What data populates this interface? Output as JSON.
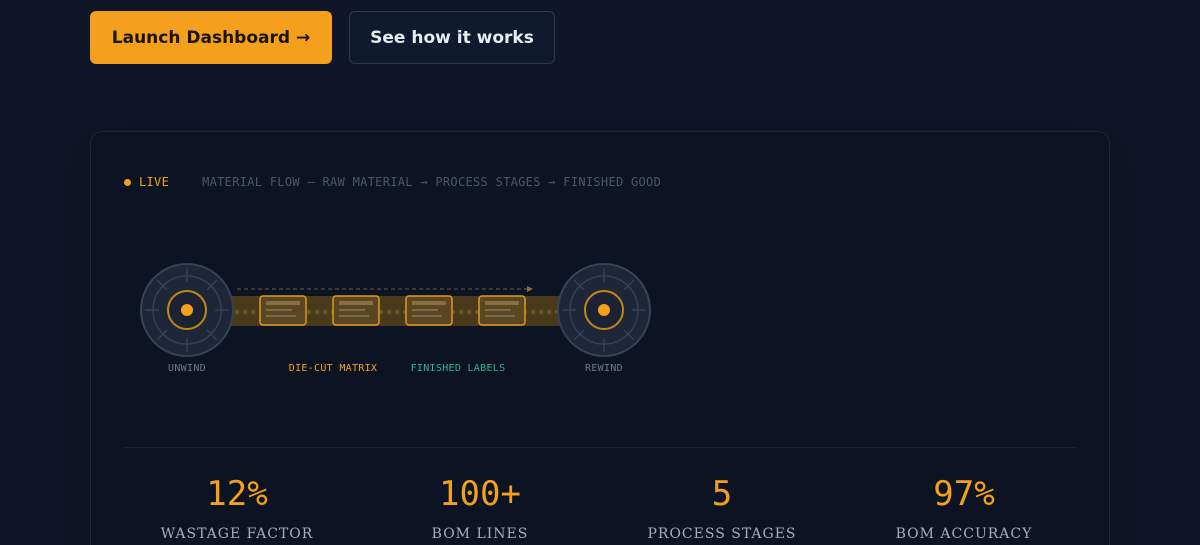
{
  "cta": {
    "primary_label": "Launch Dashboard →",
    "secondary_label": "See how it works"
  },
  "panel": {
    "live_label": "LIVE",
    "flow_caption": "MATERIAL FLOW — RAW MATERIAL → PROCESS STAGES → FINISHED GOOD",
    "captions": {
      "unwind": "UNWIND",
      "matrix": "DIE-CUT MATRIX",
      "labels": "FINISHED LABELS",
      "rewind": "REWIND"
    }
  },
  "stats": [
    {
      "value": "12%",
      "label": "WASTAGE FACTOR"
    },
    {
      "value": "100+",
      "label": "BOM LINES"
    },
    {
      "value": "5",
      "label": "PROCESS STAGES"
    },
    {
      "value": "97%",
      "label": "BOM ACCURACY"
    }
  ],
  "colors": {
    "accent": "#f4a01c",
    "background": "#0e1627",
    "card": "#0c1424",
    "teal": "#2fb59a",
    "muted": "#4c5668"
  },
  "icons": [
    "unwind-roll-icon",
    "rewind-roll-icon",
    "label-icon"
  ]
}
